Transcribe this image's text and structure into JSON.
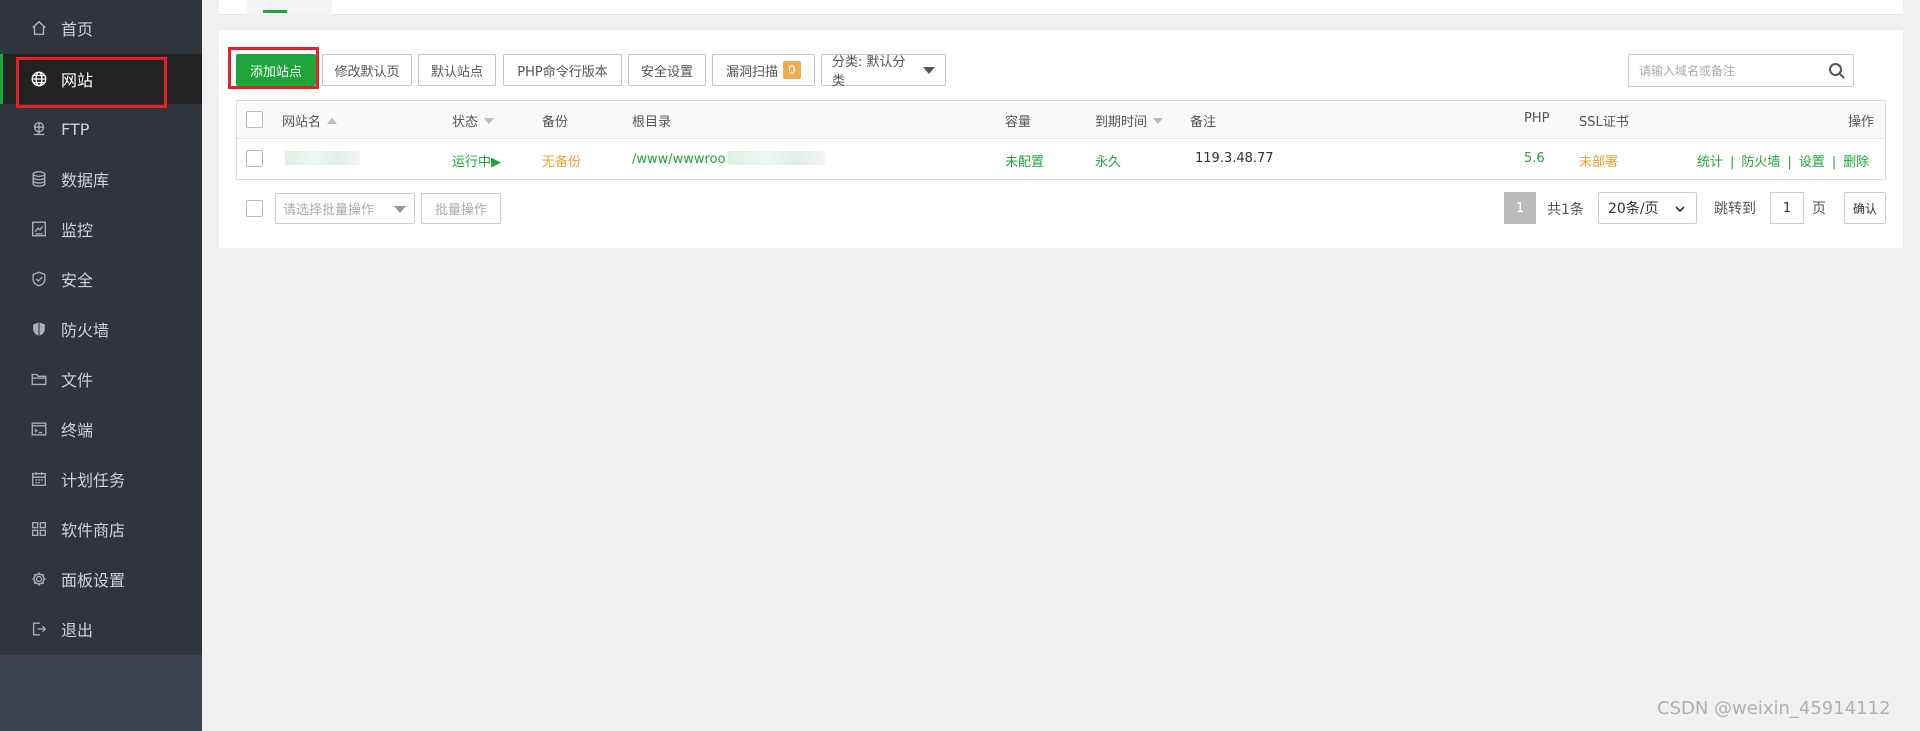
{
  "sidebar": {
    "items": [
      {
        "label": "首页",
        "icon": "home-icon"
      },
      {
        "label": "网站",
        "icon": "globe-icon",
        "active": true
      },
      {
        "label": "FTP",
        "icon": "ftp-icon"
      },
      {
        "label": "数据库",
        "icon": "database-icon"
      },
      {
        "label": "监控",
        "icon": "monitor-icon"
      },
      {
        "label": "安全",
        "icon": "shield-icon"
      },
      {
        "label": "防火墙",
        "icon": "firewall-icon"
      },
      {
        "label": "文件",
        "icon": "folder-icon"
      },
      {
        "label": "终端",
        "icon": "terminal-icon"
      },
      {
        "label": "计划任务",
        "icon": "calendar-icon"
      },
      {
        "label": "软件商店",
        "icon": "apps-icon"
      },
      {
        "label": "面板设置",
        "icon": "gear-icon"
      },
      {
        "label": "退出",
        "icon": "logout-icon"
      }
    ]
  },
  "toolbar": {
    "add_site": "添加站点",
    "edit_default_page": "修改默认页",
    "default_site": "默认站点",
    "php_cli_version": "PHP命令行版本",
    "security_settings": "安全设置",
    "vuln_scan": "漏洞扫描",
    "vuln_count": "0",
    "category": "分类: 默认分类"
  },
  "search": {
    "placeholder": "请输入域名或备注"
  },
  "table": {
    "headers": {
      "name": "网站名",
      "status": "状态",
      "backup": "备份",
      "root": "根目录",
      "capacity": "容量",
      "expire": "到期时间",
      "remark": "备注",
      "php": "PHP",
      "ssl": "SSL证书",
      "actions": "操作"
    },
    "rows": [
      {
        "status": "运行中▶",
        "backup": "无备份",
        "root": "/www/wwwroo",
        "capacity": "未配置",
        "expire": "永久",
        "remark": "119.3.48.77",
        "php": "5.6",
        "ssl": "未部署",
        "actions": [
          "统计",
          "防火墙",
          "设置",
          "删除"
        ]
      }
    ]
  },
  "footer": {
    "batch_placeholder": "请选择批量操作",
    "batch_button": "批量操作",
    "current_page": "1",
    "total": "共1条",
    "page_size": "20条/页",
    "jump_label": "跳转到",
    "jump_value": "1",
    "page_label": "页",
    "confirm": "确认"
  },
  "watermark": "CSDN @weixin_45914112",
  "colors": {
    "accent": "#20a53a",
    "warning": "#f0a030",
    "highlight": "#e5202b",
    "sidebar": "#2f353b"
  }
}
